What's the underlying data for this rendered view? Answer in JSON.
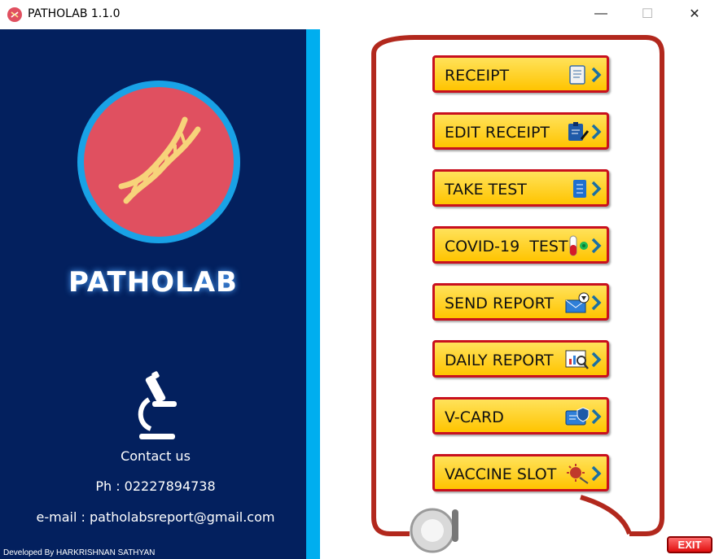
{
  "window": {
    "title": "PATHOLAB 1.1.0",
    "minimize": "—",
    "maximize": "☐",
    "close": "✕"
  },
  "brand": {
    "name": "PATHOLAB"
  },
  "contact": {
    "heading": "Contact us",
    "phone": "Ph : 02227894738",
    "email": "e-mail : patholabsreport@gmail.com"
  },
  "footer": {
    "developer": "Developed By HARKRISHNAN SATHYAN"
  },
  "menu": [
    {
      "label": "RECEIPT",
      "icon": "receipt-scroll-icon"
    },
    {
      "label": "EDIT RECEIPT",
      "icon": "clipboard-edit-icon"
    },
    {
      "label": "TAKE TEST",
      "icon": "test-list-icon"
    },
    {
      "label": "COVID-19  TEST",
      "icon": "test-tube-virus-icon"
    },
    {
      "label": "SEND REPORT",
      "icon": "envelope-send-icon"
    },
    {
      "label": "DAILY REPORT",
      "icon": "chart-magnifier-icon"
    },
    {
      "label": "V-CARD",
      "icon": "id-card-shield-icon"
    },
    {
      "label": "VACCINE SLOT",
      "icon": "virus-syringe-icon"
    }
  ],
  "exit_label": "EXIT",
  "colors": {
    "panel": "#03205e",
    "accent": "#00aeef",
    "button": "#ffd21f",
    "button_border": "#c8101e",
    "logo": "#e05060"
  }
}
